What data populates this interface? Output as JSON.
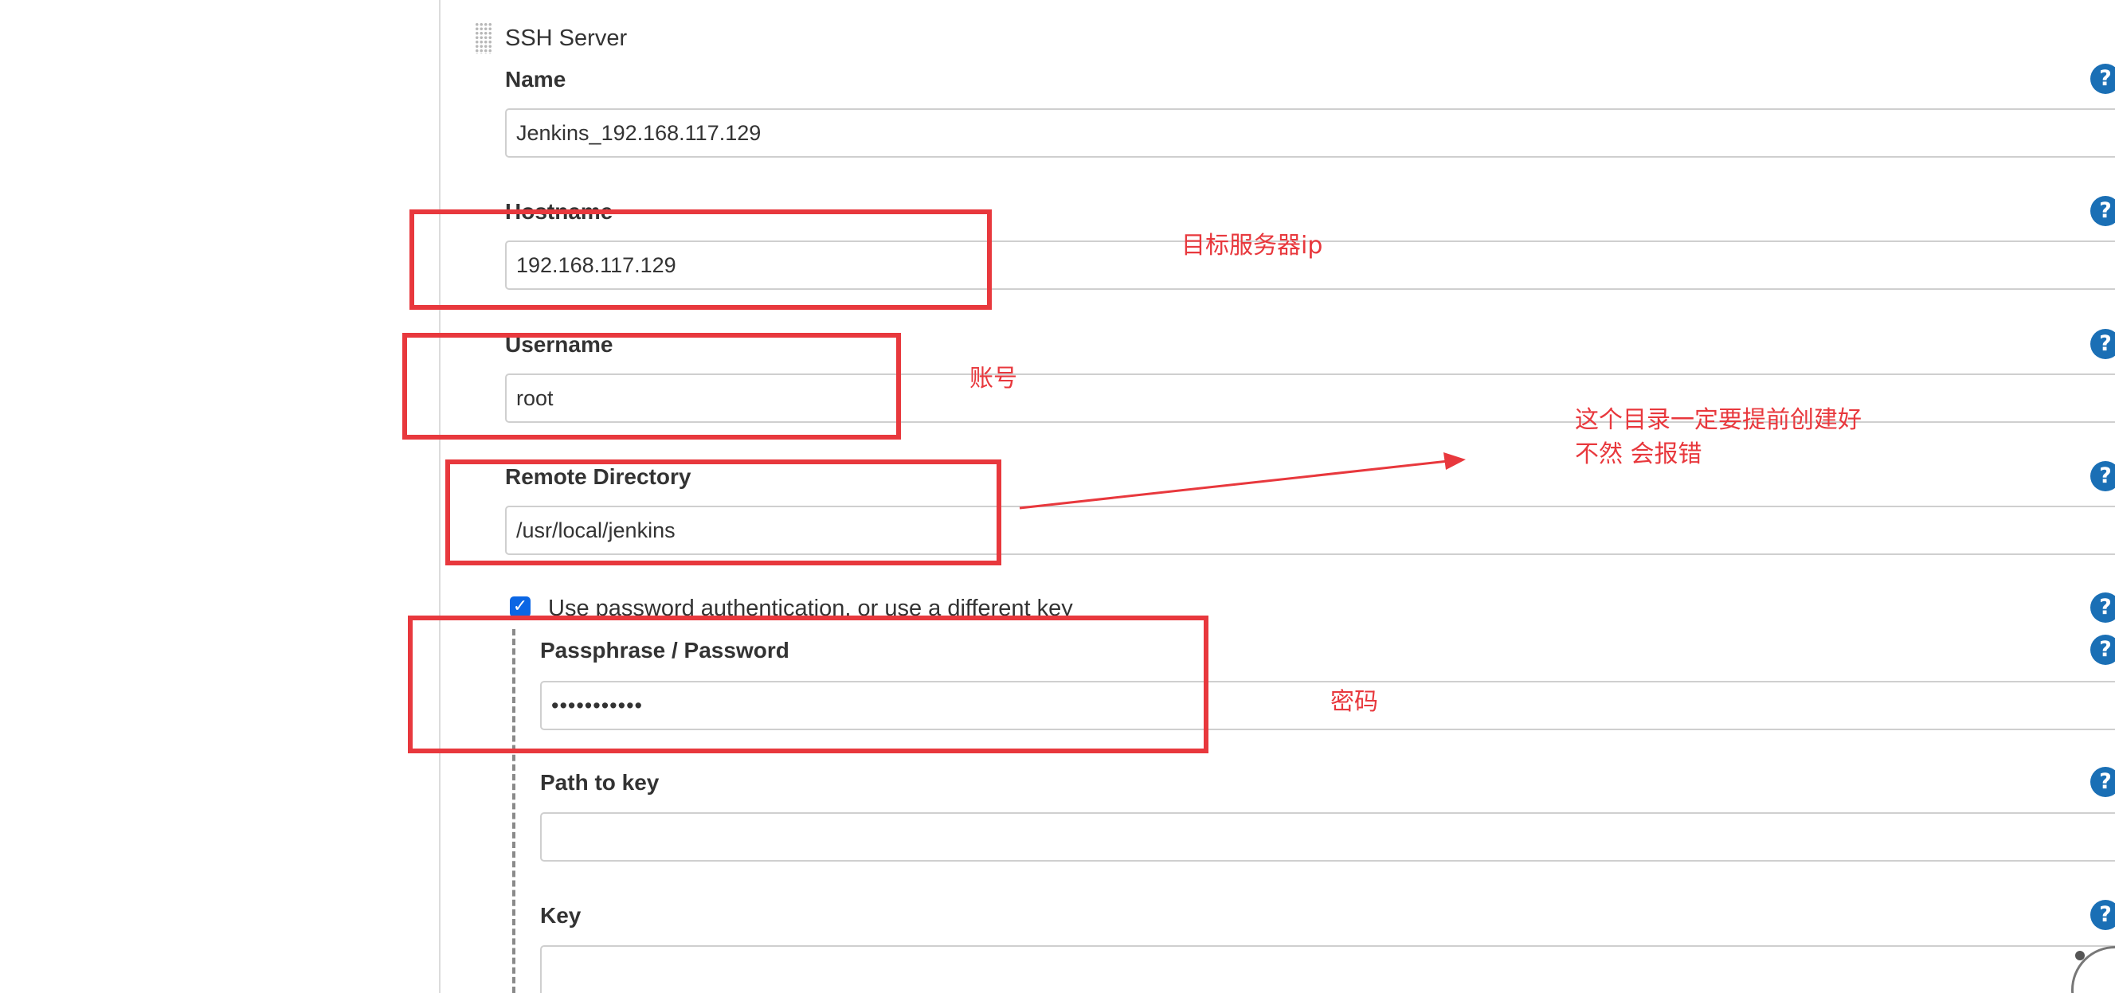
{
  "section": {
    "title": "SSH Server"
  },
  "fields": {
    "name": {
      "label": "Name",
      "value": "Jenkins_192.168.117.129"
    },
    "hostname": {
      "label": "Hostname",
      "value": "192.168.117.129"
    },
    "username": {
      "label": "Username",
      "value": "root"
    },
    "remote_directory": {
      "label": "Remote Directory",
      "value": "/usr/local/jenkins"
    },
    "use_password_auth": {
      "label": "Use password authentication, or use a different key",
      "checked": true
    },
    "passphrase": {
      "label": "Passphrase / Password",
      "value": "•••••••••••"
    },
    "path_to_key": {
      "label": "Path to key",
      "value": ""
    },
    "key": {
      "label": "Key",
      "value": ""
    }
  },
  "help_icon_glyph": "?",
  "checkbox_glyph": "✓",
  "annotations": {
    "hostname_note": "目标服务器ip",
    "username_note": "账号",
    "directory_note_line1": "这个目录一定要提前创建好",
    "directory_note_line2": "不然 会报错",
    "password_note": "密码"
  },
  "colors": {
    "annotation_red": "#e8383d",
    "help_icon_blue": "#1a6fb5",
    "checkbox_blue": "#0b66e4"
  },
  "icons": [
    "drag-handle-icon",
    "help-icon",
    "checkbox-checked-icon"
  ]
}
